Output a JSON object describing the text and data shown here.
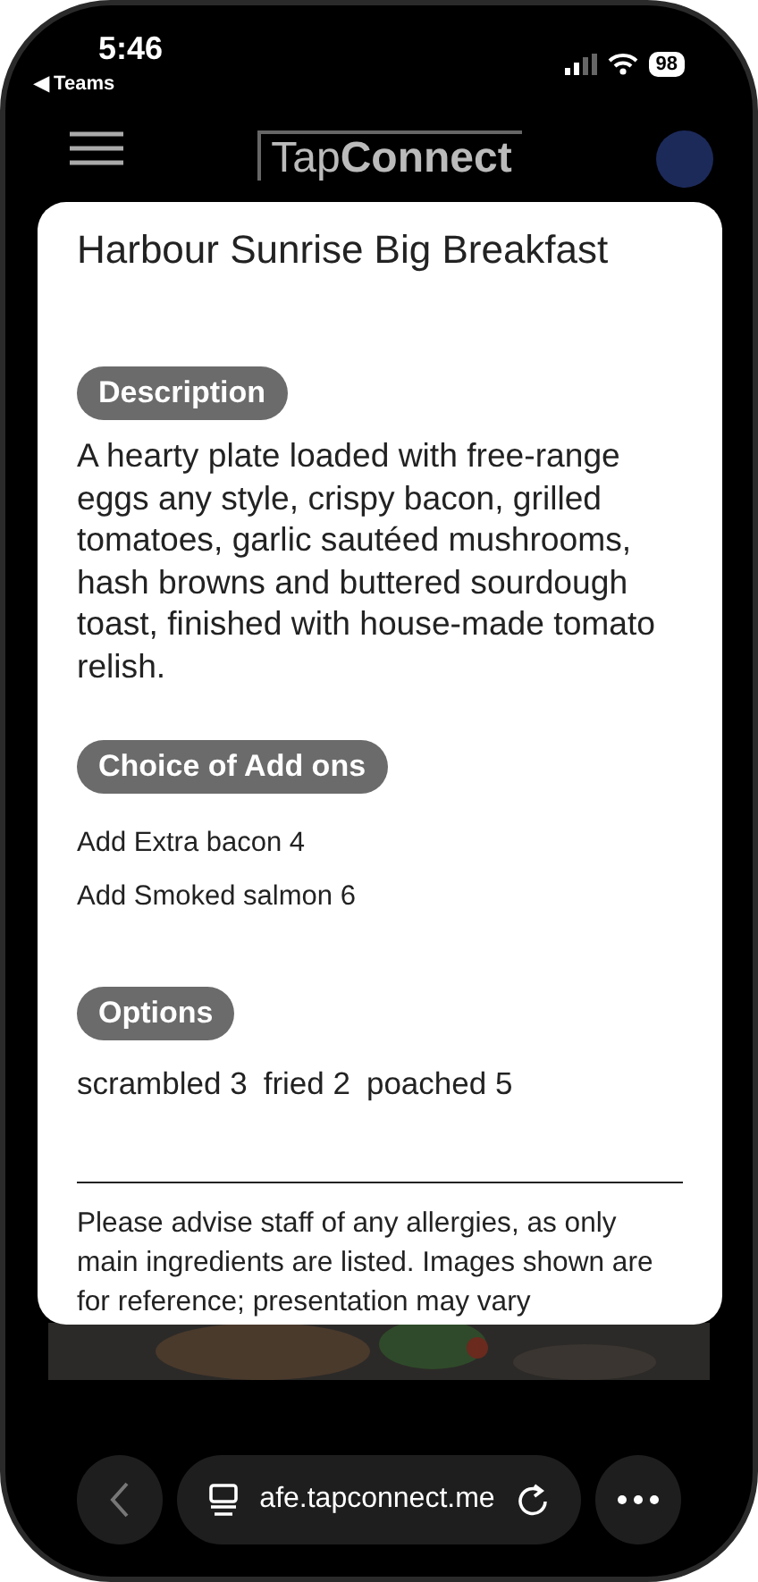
{
  "status_bar": {
    "time": "5:46",
    "back_app": "◀ Teams",
    "battery": "98"
  },
  "header": {
    "logo": [
      "Tap",
      "Connect"
    ]
  },
  "modal": {
    "title": "Harbour Sunrise Big Breakfast",
    "sections": [
      {
        "kind": "paragraph",
        "heading": "Description",
        "text": "A hearty plate loaded with free-range eggs any style, crispy bacon, grilled tomatoes, garlic sautéed mushrooms, hash browns and buttered sourdough toast, finished with house-made tomato relish."
      },
      {
        "kind": "list",
        "heading": "Choice of Add ons",
        "items": [
          "Add Extra bacon 4",
          "Add Smoked salmon 6"
        ]
      },
      {
        "kind": "inline",
        "heading": "Options",
        "items": [
          "scrambled 3",
          "fried 2",
          "poached 5"
        ]
      }
    ],
    "footer": "Please advise staff of any allergies, as only main ingredients are listed. Images shown are for reference; presentation may vary"
  },
  "browser_bar": {
    "url": "afe.tapconnect.me"
  }
}
